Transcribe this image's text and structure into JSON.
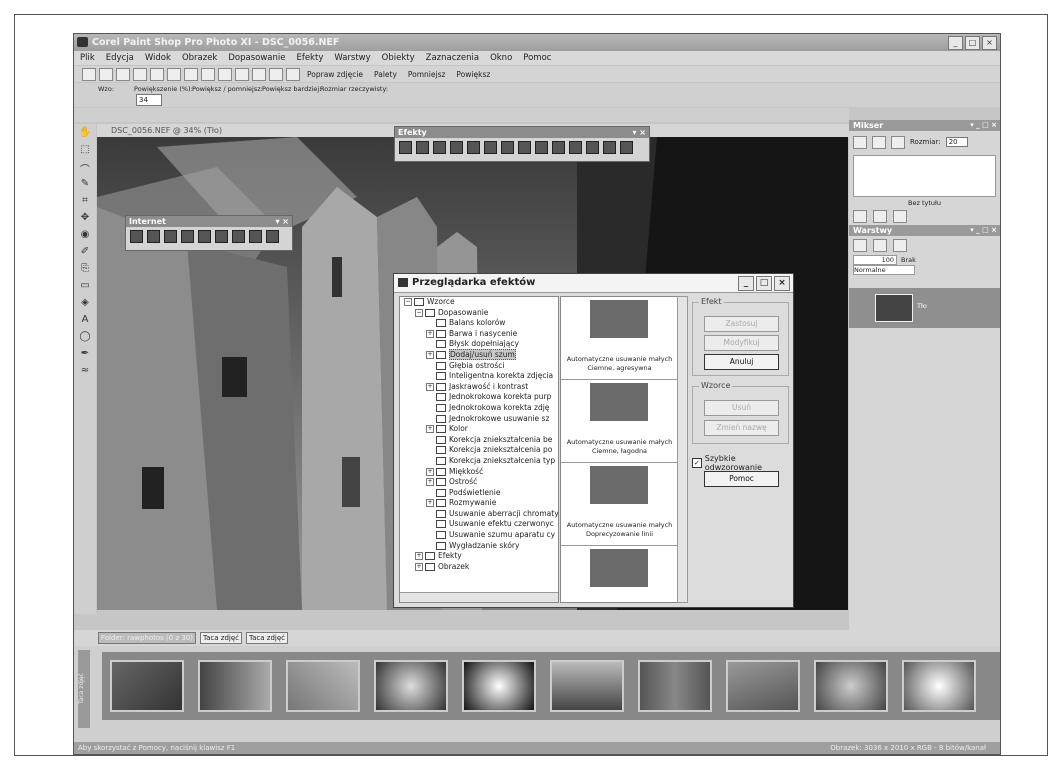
{
  "window": {
    "title": "Corel Paint Shop Pro Photo XI - DSC_0056.NEF",
    "controls": [
      "_",
      "□",
      "×"
    ]
  },
  "menu": [
    "Plik",
    "Edycja",
    "Widok",
    "Obrazek",
    "Dopasowanie",
    "Efekty",
    "Warstwy",
    "Obiekty",
    "Zaznaczenia",
    "Okno",
    "Pomoc"
  ],
  "toolbar1": {
    "items": [
      "Popraw zdjęcie",
      "Palety",
      "Pomniejsz",
      "Powiększ"
    ]
  },
  "toolbar2": {
    "labels": [
      "Wzo:",
      "Powiększenie (%):",
      "Powiększ / pomniejsz:",
      "Powiększ bardziej:",
      "Rozmiar rzeczywisty:"
    ],
    "zoom_value": "34"
  },
  "document": {
    "title": "DSC_0056.NEF @ 34% (Tło)"
  },
  "floating_toolbars": {
    "effects": "Efekty",
    "internet": "Internet"
  },
  "mixer": {
    "title": "Mikser",
    "size_label": "Rozmiar:",
    "size_value": "20",
    "untitled": "Bez tytułu"
  },
  "layers": {
    "title": "Warstwy",
    "opacity": "100",
    "brak": "Brak",
    "blend_mode": "Normalne",
    "layer_name": "Tło"
  },
  "dialog": {
    "title": "Przeglądarka efektów",
    "tree": [
      {
        "label": "Wzorce",
        "level": 0,
        "expander": "−"
      },
      {
        "label": "Dopasowanie",
        "level": 1,
        "expander": "−"
      },
      {
        "label": "Balans kolorów",
        "level": 2,
        "expander": ""
      },
      {
        "label": "Barwa i nasycenie",
        "level": 2,
        "expander": "+"
      },
      {
        "label": "Błysk dopełniający",
        "level": 2,
        "expander": ""
      },
      {
        "label": "Dodaj/usuń szum",
        "level": 2,
        "expander": "+",
        "selected": true
      },
      {
        "label": "Głębia ostrości",
        "level": 2,
        "expander": ""
      },
      {
        "label": "Inteligentna korekta zdjęcia",
        "level": 2,
        "expander": ""
      },
      {
        "label": "Jaskrawość i kontrast",
        "level": 2,
        "expander": "+"
      },
      {
        "label": "Jednokrokowa korekta purp",
        "level": 2,
        "expander": ""
      },
      {
        "label": "Jednokrokowa korekta zdję",
        "level": 2,
        "expander": ""
      },
      {
        "label": "Jednokrokowe usuwanie sz",
        "level": 2,
        "expander": ""
      },
      {
        "label": "Kolor",
        "level": 2,
        "expander": "+"
      },
      {
        "label": "Korekcja zniekształcenia be",
        "level": 2,
        "expander": ""
      },
      {
        "label": "Korekcja zniekształcenia po",
        "level": 2,
        "expander": ""
      },
      {
        "label": "Korekcja zniekształcenia typ",
        "level": 2,
        "expander": ""
      },
      {
        "label": "Miękkość",
        "level": 2,
        "expander": "+"
      },
      {
        "label": "Ostrość",
        "level": 2,
        "expander": "+"
      },
      {
        "label": "Podświetlenie",
        "level": 2,
        "expander": ""
      },
      {
        "label": "Rozmywanie",
        "level": 2,
        "expander": "+"
      },
      {
        "label": "Usuwanie aberracji chromaty",
        "level": 2,
        "expander": ""
      },
      {
        "label": "Usuwanie efektu czerwonyc",
        "level": 2,
        "expander": ""
      },
      {
        "label": "Usuwanie szumu aparatu cy",
        "level": 2,
        "expander": ""
      },
      {
        "label": "Wygładzanie skóry",
        "level": 2,
        "expander": ""
      },
      {
        "label": "Efekty",
        "level": 1,
        "expander": "+"
      },
      {
        "label": "Obrazek",
        "level": 1,
        "expander": "+"
      }
    ],
    "thumbnails": [
      {
        "caption1": "Automatyczne usuwanie małych",
        "caption2": "Ciemne, agresywna"
      },
      {
        "caption1": "Automatyczne usuwanie małych",
        "caption2": "Ciemne, łagodna"
      },
      {
        "caption1": "Automatyczne usuwanie małych",
        "caption2": "Doprecyzowanie linii"
      },
      {
        "caption1": "",
        "caption2": ""
      }
    ],
    "group_effect": "Efekt",
    "buttons_effect": [
      "Zastosuj",
      "Modyfikuj",
      "Anuluj"
    ],
    "group_presets": "Wzorce",
    "buttons_presets": [
      "Usuń",
      "Zmień nazwę"
    ],
    "fast_render_label": "Szybkie odwzorowanie",
    "help_label": "Pomoc"
  },
  "organizer": {
    "folder_tab": "Folder: rawphotos (0 z 30)",
    "tabs": [
      "Taca zdjęć",
      "Taca zdjęć"
    ],
    "side_label": "Taca zdjęć"
  },
  "status": {
    "left": "Aby skorzystać z Pomocy, naciśnij klawisz F1",
    "right": "Obrazek: 3036 x 2010 x RGB - 8 bitów/kanał"
  }
}
